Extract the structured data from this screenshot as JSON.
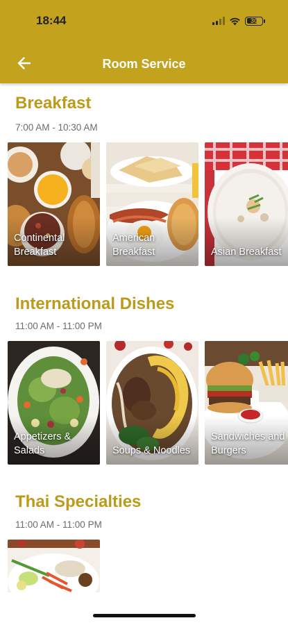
{
  "status_bar": {
    "time": "18:44",
    "battery": "30"
  },
  "header": {
    "title": "Room Service"
  },
  "sections": [
    {
      "title": "Breakfast",
      "hours": "7:00 AM - 10:30 AM",
      "items": [
        {
          "label": "Continental\nBreakfast"
        },
        {
          "label": "American\nBreakfast"
        },
        {
          "label": "Asian Breakfast"
        }
      ]
    },
    {
      "title": "International Dishes",
      "hours": "11:00 AM - 11:00 PM",
      "items": [
        {
          "label": "Appetizers &\nSalads"
        },
        {
          "label": "Soups & Noodles"
        },
        {
          "label": "Sandwiches and\nBurgers"
        }
      ]
    },
    {
      "title": "Thai Specialties",
      "hours": "11:00 AM - 11:00 PM",
      "items": [
        {
          "label": ""
        }
      ]
    }
  ],
  "colors": {
    "accent": "#c3a21d",
    "section_title": "#bc9a1a"
  }
}
